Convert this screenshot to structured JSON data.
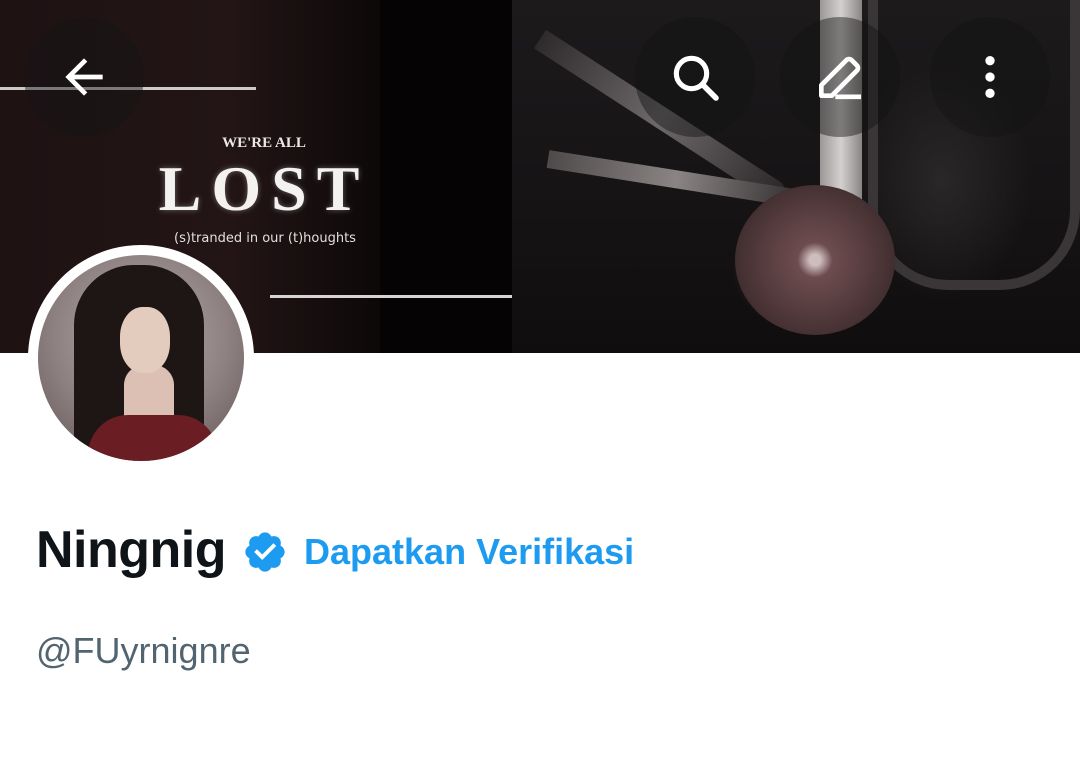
{
  "banner": {
    "pre_title": "WE'RE ALL",
    "title": "LOST",
    "subtitle": "(s)tranded in our (t)houghts"
  },
  "header_actions": {
    "back_icon": "arrow-left-icon",
    "search_icon": "search-icon",
    "edit_icon": "pencil-icon",
    "more_icon": "more-vertical-icon"
  },
  "profile": {
    "name": "Ningnig",
    "verified_icon": "verified-badge-icon",
    "get_verified_label": "Dapatkan Verifikasi",
    "handle": "@FUyrnignre"
  },
  "colors": {
    "accent": "#1d9bf0",
    "name_text": "#0f1419",
    "secondary_text": "#536471"
  }
}
